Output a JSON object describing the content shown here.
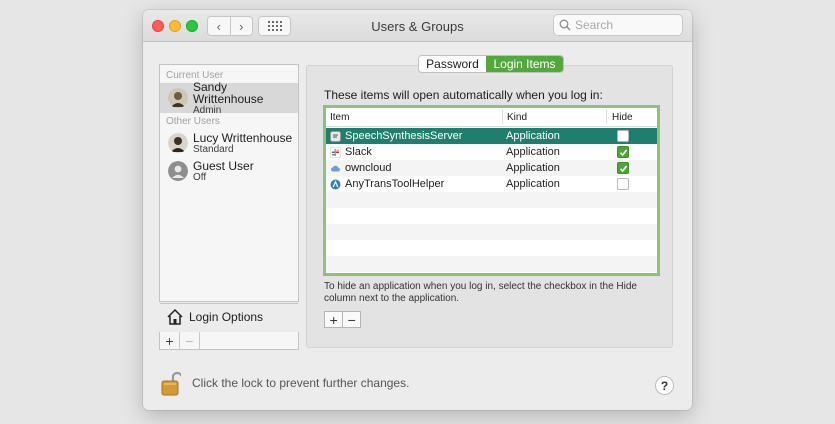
{
  "window": {
    "title": "Users & Groups"
  },
  "titlebar": {
    "back_glyph": "‹",
    "forward_glyph": "›",
    "search_placeholder": "Search"
  },
  "sidebar": {
    "current_user_header": "Current User",
    "other_users_header": "Other Users",
    "users": [
      {
        "name": "Sandy Writtenhouse",
        "role": "Admin",
        "selected": true
      },
      {
        "name": "Lucy Writtenhouse",
        "role": "Standard"
      },
      {
        "name": "Guest User",
        "role": "Off"
      }
    ],
    "login_options_label": "Login Options",
    "add_glyph": "+",
    "remove_glyph": "−"
  },
  "tabs": [
    {
      "label": "Password",
      "selected": false
    },
    {
      "label": "Login Items",
      "selected": true
    }
  ],
  "login_items": {
    "intro": "These items will open automatically when you log in:",
    "columns": {
      "item": "Item",
      "kind": "Kind",
      "hide": "Hide"
    },
    "rows": [
      {
        "item": "SpeechSynthesisServer",
        "kind": "Application",
        "hide": false,
        "selected": true,
        "icon": "speech-icon"
      },
      {
        "item": "Slack",
        "kind": "Application",
        "hide": true,
        "icon": "slack-icon"
      },
      {
        "item": "owncloud",
        "kind": "Application",
        "hide": true,
        "icon": "cloud-icon"
      },
      {
        "item": "AnyTransToolHelper",
        "kind": "Application",
        "hide": false,
        "icon": "anytrans-icon"
      }
    ],
    "hint": "To hide an application when you log in, select the checkbox in the Hide column next to the application.",
    "add_glyph": "+",
    "remove_glyph": "−"
  },
  "footer": {
    "lock_text": "Click the lock to prevent further changes.",
    "help_glyph": "?"
  },
  "colors": {
    "accent_green": "#52a93b",
    "selection_teal": "#1f7f6e",
    "table_border": "#8cc27a"
  }
}
